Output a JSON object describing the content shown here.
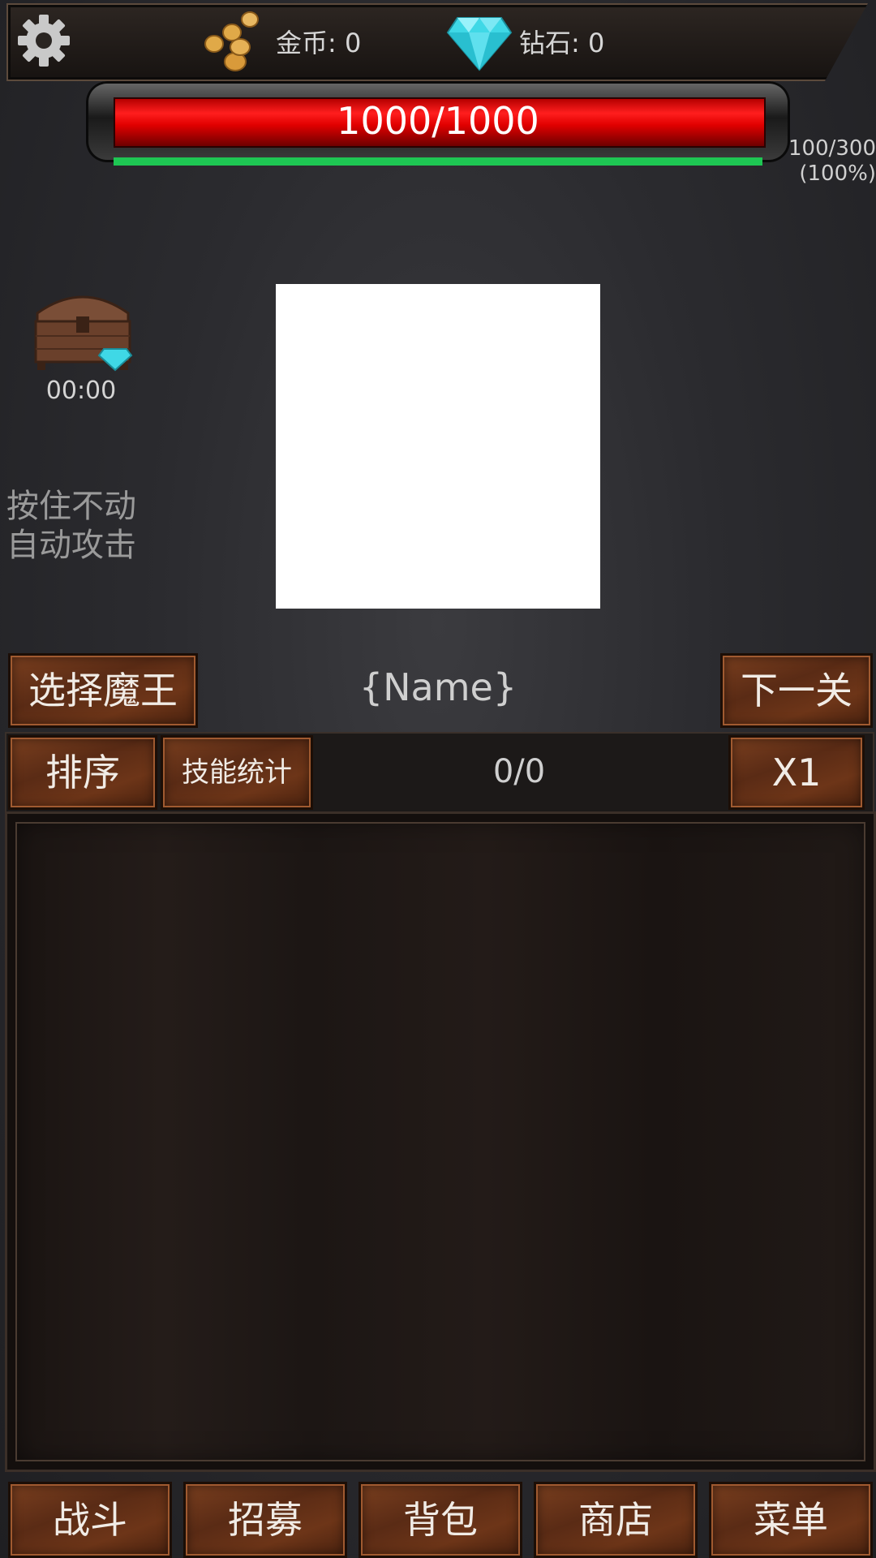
{
  "topbar": {
    "settings_icon": "gear-icon",
    "gold_label": "金币:  0",
    "diamond_label": "钻石:  0",
    "coin_icon": "coin-stack-icon",
    "diamond_icon": "diamond-icon"
  },
  "boss": {
    "hp_text": "1000/1000",
    "hp_fraction": 1.0,
    "mana_fraction": 1.0,
    "progress_line1": "100/300",
    "progress_line2": "(100%)",
    "name": "{Name}"
  },
  "chest": {
    "icon": "treasure-chest-icon",
    "timer": "00:00"
  },
  "hint": {
    "line1": "按住不动",
    "line2": "自动攻击"
  },
  "buttons": {
    "select_boss": "选择魔王",
    "next_level": "下一关",
    "sort": "排序",
    "skill_stats": "技能统计",
    "speed": "X1"
  },
  "counter": "0/0",
  "nav": {
    "battle": "战斗",
    "recruit": "招募",
    "bag": "背包",
    "shop": "商店",
    "menu": "菜单"
  },
  "colors": {
    "hp": "#e10000",
    "mana": "#1ec653",
    "wood": "#6d3518"
  }
}
